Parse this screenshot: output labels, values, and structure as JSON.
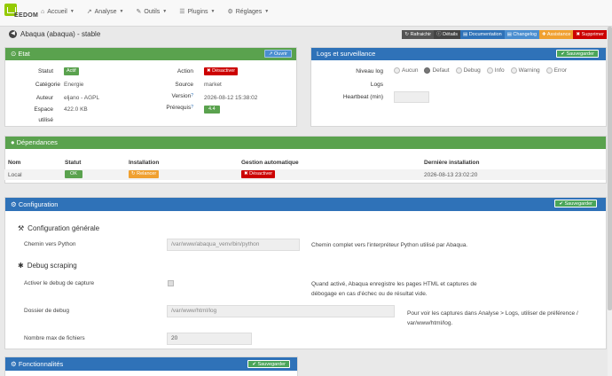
{
  "logo": {
    "text": "EEDOM"
  },
  "nav": {
    "items": [
      {
        "label": "Accueil",
        "icon": "home-icon"
      },
      {
        "label": "Analyse",
        "icon": "analyse-icon"
      },
      {
        "label": "Outils",
        "icon": "wrench-icon"
      },
      {
        "label": "Plugins",
        "icon": "list-icon"
      },
      {
        "label": "Réglages",
        "icon": "gear-icon"
      }
    ]
  },
  "page": {
    "title": "Abaqua (abaqua) - stable"
  },
  "toolbar": {
    "refresh": "Rafraichir",
    "details": "Détails",
    "documentation": "Documentation",
    "changelog": "Changelog",
    "assistance": "Assistance",
    "delete": "Supprimer"
  },
  "colors": {
    "green": "#5aa24e",
    "blue": "#2f72b8",
    "red": "#cc0000",
    "orange": "#f0a030"
  },
  "etat": {
    "title": "Etat",
    "open_label": "Ouvrir",
    "statut_label": "Statut",
    "statut_value": "Actif",
    "categorie_label": "Catégorie",
    "categorie_value": "Energie",
    "auteur_label": "Auteur",
    "auteur_value": "eljano - AGPL",
    "espace_label": "Espace",
    "espace_label2": "utilisé",
    "espace_value": "422.0 KB",
    "action_label": "Action",
    "action_value": "Désactiver",
    "source_label": "Source",
    "source_value": "market",
    "version_label": "Version",
    "version_value": "2026-08-12 15:38:02",
    "prerequis_label": "Prérequis",
    "prerequis_value": "4.4"
  },
  "logs": {
    "title": "Logs et surveillance",
    "save_label": "Sauvegarder",
    "niveau_label": "Niveau log",
    "options": [
      "Aucun",
      "Defaut",
      "Debug",
      "Info",
      "Warning",
      "Error"
    ],
    "selected": "Defaut",
    "logs_label": "Logs",
    "heartbeat_label": "Heartbeat (min)",
    "heartbeat_value": ""
  },
  "dependances": {
    "title": "Dépendances",
    "headers": {
      "nom": "Nom",
      "statut": "Statut",
      "installation": "Installation",
      "gestion": "Gestion automatique",
      "derniere": "Dernière installation"
    },
    "row": {
      "nom": "Local",
      "statut": "OK",
      "relancer": "Relancer",
      "desactiver": "Désactiver",
      "derniere": "2026-08-13 23:02:20"
    }
  },
  "configuration": {
    "title": "Configuration",
    "save_label": "Sauvegarder",
    "general_title": "Configuration générale",
    "python_label": "Chemin vers Python",
    "python_value": "/var/www/abaqua_venv/bin/python",
    "python_help": "Chemin complet vers l'interpréteur Python utilisé par Abaqua.",
    "debug_title": "Debug scraping",
    "debug_capture_label": "Activer le debug de capture",
    "debug_capture_help_1": "Quand activé, Abaqua enregistre les pages HTML et captures de",
    "debug_capture_help_2": "débogage en cas d'échec ou de résultat vide.",
    "debug_dir_label": "Dossier de debug",
    "debug_dir_value": "/var/www/html/log",
    "debug_dir_help_1": "Pour voir les captures dans Analyse > Logs, utiliser de préférence /",
    "debug_dir_help_2": "var/www/html/log.",
    "max_files_label": "Nombre max de fichiers",
    "max_files_value": "20"
  },
  "fonctionnalites": {
    "title": "Fonctionnalités",
    "save_label": "Sauvegarder"
  }
}
